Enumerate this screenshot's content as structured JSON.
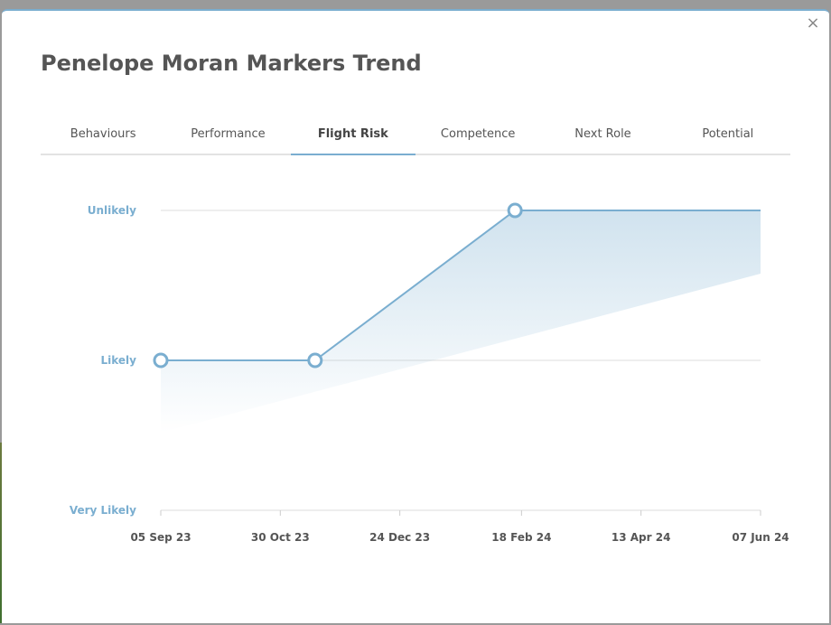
{
  "modal": {
    "title": "Penelope Moran Markers Trend",
    "close_glyph": "×",
    "close_icon": "close-icon"
  },
  "tabs": [
    {
      "label": "Behaviours",
      "active": false
    },
    {
      "label": "Performance",
      "active": false
    },
    {
      "label": "Flight Risk",
      "active": true
    },
    {
      "label": "Competence",
      "active": false
    },
    {
      "label": "Next Role",
      "active": false
    },
    {
      "label": "Potential",
      "active": false
    }
  ],
  "colors": {
    "accent": "#7aaed0",
    "title": "#555555",
    "axis_text": "#555555"
  },
  "chart_data": {
    "type": "area",
    "levels": [
      "Very Likely",
      "Likely",
      "Unlikely"
    ],
    "x_ticks": [
      "05 Sep 23",
      "30 Oct 23",
      "24 Dec 23",
      "18 Feb 24",
      "13 Apr 24",
      "07 Jun 24"
    ],
    "x_range": [
      "05 Sep 23",
      "07 Jun 24"
    ],
    "points": [
      {
        "x": "05 Sep 23",
        "y": "Likely"
      },
      {
        "x": "15 Nov 23",
        "y": "Likely"
      },
      {
        "x": "15 Feb 24",
        "y": "Unlikely"
      }
    ],
    "line_extends_to": "07 Jun 24",
    "grid": true
  }
}
